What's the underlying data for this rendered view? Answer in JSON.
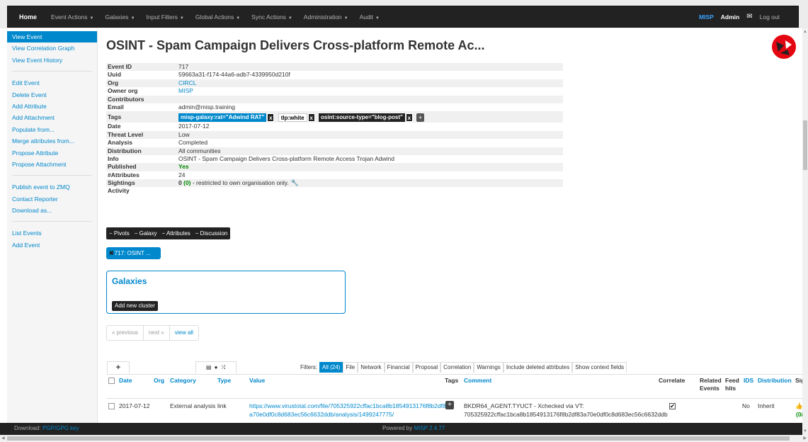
{
  "nav": {
    "home": "Home",
    "menus": [
      "Event Actions",
      "Galaxies",
      "Input Filters",
      "Global Actions",
      "Sync Actions",
      "Administration",
      "Audit"
    ],
    "brand": "MISP",
    "user": "Admin",
    "logout": "Log out"
  },
  "sidebar": {
    "group1": [
      "View Event",
      "View Correlation Graph",
      "View Event History"
    ],
    "group2": [
      "Edit Event",
      "Delete Event",
      "Add Attribute",
      "Add Attachment",
      "Populate from...",
      "Merge attributes from...",
      "Propose Attribute",
      "Propose Attachment"
    ],
    "group3": [
      "Publish event to ZMQ",
      "Contact Reporter",
      "Download as..."
    ],
    "group4": [
      "List Events",
      "Add Event"
    ]
  },
  "event": {
    "title": "OSINT - Spam Campaign Delivers Cross-platform Remote Ac...",
    "labels": {
      "event_id": "Event ID",
      "uuid": "Uuid",
      "org": "Org",
      "owner_org": "Owner org",
      "contributors": "Contributors",
      "email": "Email",
      "tags": "Tags",
      "date": "Date",
      "threat_level": "Threat Level",
      "analysis": "Analysis",
      "distribution": "Distribution",
      "info": "Info",
      "published": "Published",
      "attributes": "#Attributes",
      "sightings": "Sightings",
      "activity": "Activity"
    },
    "event_id": "717",
    "uuid": "59663a31-f174-44a6-adb7-4339950d210f",
    "org": "CIRCL",
    "owner_org": "MISP",
    "contributors": "",
    "email": "admin@misp.training",
    "tags": [
      "misp-galaxy:rat=\"Adwind RAT\"",
      "tlp:white",
      "osint:source-type=\"blog-post\""
    ],
    "tag_remove": "x",
    "tag_add": "+",
    "date": "2017-07-12",
    "threat_level": "Low",
    "analysis": "Completed",
    "distribution": "All communities",
    "info": "OSINT - Spam Campaign Delivers Cross-platform Remote Access Trojan Adwind",
    "published": "Yes",
    "attributes": "24",
    "sightings_count": "0",
    "sightings_own": "(0)",
    "sightings_note": " - restricted to own organisation only.",
    "activity": ""
  },
  "toggles": [
    "Pivots",
    "Galaxy",
    "Attributes",
    "Discussion"
  ],
  "pivot_label": "717: OSINT ...",
  "galaxies": {
    "title": "Galaxies",
    "add_button": "Add new cluster"
  },
  "pagination": {
    "previous": "« previous",
    "next": "next »",
    "view_all": "view all"
  },
  "attr_add": "+",
  "filters": {
    "label": "Filters:",
    "items": [
      "All (24)",
      "File",
      "Network",
      "Financial",
      "Proposal",
      "Correlation",
      "Warnings",
      "Include deleted attributes",
      "Show context fields"
    ],
    "active": "All (24)"
  },
  "table": {
    "headers": {
      "date": "Date",
      "org": "Org",
      "category": "Category",
      "type": "Type",
      "value": "Value",
      "tags": "Tags",
      "comment": "Comment",
      "correlate": "Correlate",
      "related_1": "Related",
      "related_2": "Events",
      "feed_1": "Feed",
      "feed_2": "hits",
      "ids": "IDS",
      "distribution": "Distribution",
      "sightings": "Sig"
    },
    "rows": [
      {
        "date": "2017-07-12",
        "org": "",
        "category": "External analysis",
        "type": "link",
        "value_1": "https://www.virustotal.com/file/705325922cffac1bca8b1854913176f8b2df83",
        "value_2": "a70e0df0c8d683ec56c6632ddb/analysis/1499247775/",
        "tag_add": "+",
        "comment_1": "BKDR64_AGENT.TYUCT - Xchecked via VT:",
        "comment_2": "705325922cffac1bca8b1854913176f8b2df83a70e0df0c8d683ec56c6632ddb",
        "correlate": true,
        "ids": "No",
        "distribution": "Inherit",
        "sightings": "(0/"
      }
    ]
  },
  "footer": {
    "download_prefix": "Download: ",
    "download_link": "PGP/GPG key",
    "powered_prefix": "Powered by ",
    "powered_link": "MISP 2.4.77"
  }
}
